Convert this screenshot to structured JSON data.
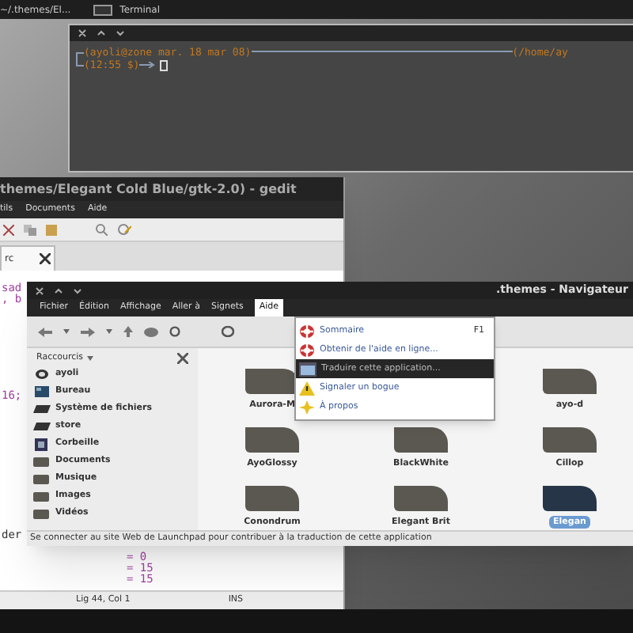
{
  "taskbar": {
    "items": [
      {
        "label": "~/.themes/El...",
        "kind": "text"
      },
      {
        "label": "Terminal",
        "kind": "terminal"
      }
    ]
  },
  "terminal": {
    "prompt_info": "(ayoli@zone mar. 18 mar 08)",
    "prompt_path": "(/home/ay",
    "prompt_time": "(12:55 $)"
  },
  "gedit": {
    "title": "themes/Elegant Cold Blue/gtk-2.0) - gedit",
    "menu": [
      "tils",
      "Documents",
      "Aide"
    ],
    "tab": "rc",
    "lines": [
      "sad",
      ", b",
      "16;",
      "der",
      "= 0",
      "= 15",
      "= 15"
    ],
    "status": {
      "position": "Lig 44, Col 1",
      "mode": "INS"
    }
  },
  "nautilus": {
    "title": ".themes - Navigateur",
    "menu": [
      {
        "label": "Fichier",
        "selected": false
      },
      {
        "label": "Édition",
        "selected": false
      },
      {
        "label": "Affichage",
        "selected": false
      },
      {
        "label": "Aller à",
        "selected": false
      },
      {
        "label": "Signets",
        "selected": false
      },
      {
        "label": "Aide",
        "selected": true
      }
    ],
    "sidebar": {
      "heading": "Raccourcis",
      "items": [
        {
          "label": "ayoli",
          "kind": "home"
        },
        {
          "label": "Bureau",
          "kind": "desktop"
        },
        {
          "label": "Système de fichiers",
          "kind": "drive"
        },
        {
          "label": "store",
          "kind": "drive"
        },
        {
          "label": "Corbeille",
          "kind": "trash"
        },
        {
          "label": "Documents",
          "kind": "folder"
        },
        {
          "label": "Musique",
          "kind": "folder"
        },
        {
          "label": "Images",
          "kind": "folder"
        },
        {
          "label": "Vidéos",
          "kind": "folder"
        }
      ]
    },
    "folders": [
      {
        "label": "Aurora-M",
        "selected": false
      },
      {
        "label": "ayo-d",
        "selected": false
      },
      {
        "label": "AyoGlossy",
        "selected": false
      },
      {
        "label": "BlackWhite",
        "selected": false
      },
      {
        "label": "Cillop",
        "selected": false
      },
      {
        "label": "Conondrum",
        "selected": false
      },
      {
        "label": "Elegant Brit",
        "selected": false
      },
      {
        "label": "Elegan",
        "selected": true
      }
    ],
    "status": "Se connecter au site Web de Launchpad pour contribuer à la traduction de cette application"
  },
  "help_menu": [
    {
      "label": "Sommaire",
      "shortcut": "F1",
      "kind": "lifebuoy",
      "selected": false
    },
    {
      "label": "Obtenir de l'aide en ligne...",
      "kind": "lifebuoy",
      "selected": false
    },
    {
      "label": "Traduire cette application...",
      "kind": "window",
      "selected": true
    },
    {
      "label": "Signaler un bogue",
      "kind": "warning",
      "selected": false
    },
    {
      "label": "À propos",
      "kind": "star",
      "selected": false
    }
  ]
}
